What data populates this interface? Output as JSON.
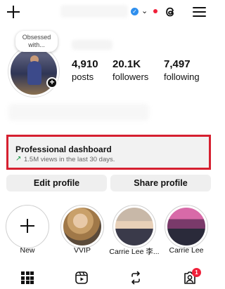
{
  "topbar": {
    "create_icon": "plus-icon",
    "verified_icon": "verified-badge-icon",
    "switch_icon": "chevron-down-icon",
    "threads_icon": "threads-icon",
    "menu_icon": "hamburger-menu-icon",
    "notification_dot_color": "#f0203a"
  },
  "profile": {
    "note_line1": "Obsessed",
    "note_line2": "with...",
    "stats": [
      {
        "value": "4,910",
        "label": "posts"
      },
      {
        "value": "20.1K",
        "label": "followers"
      },
      {
        "value": "7,497",
        "label": "following"
      }
    ]
  },
  "dashboard": {
    "title": "Professional dashboard",
    "subtitle": "1.5M views in the last 30 days.",
    "highlight_border_color": "#d62030",
    "trend_color": "#1c9a4a"
  },
  "actions": {
    "edit_label": "Edit profile",
    "share_label": "Share profile"
  },
  "highlights": [
    {
      "label": "New"
    },
    {
      "label": "VVIP"
    },
    {
      "label": "Carrie Lee 李..."
    },
    {
      "label": "Carrie Lee"
    }
  ],
  "bottom_nav": {
    "items": [
      "grid-icon",
      "reels-icon",
      "repost-icon",
      "tagged-icon"
    ],
    "badge_count": "1"
  }
}
